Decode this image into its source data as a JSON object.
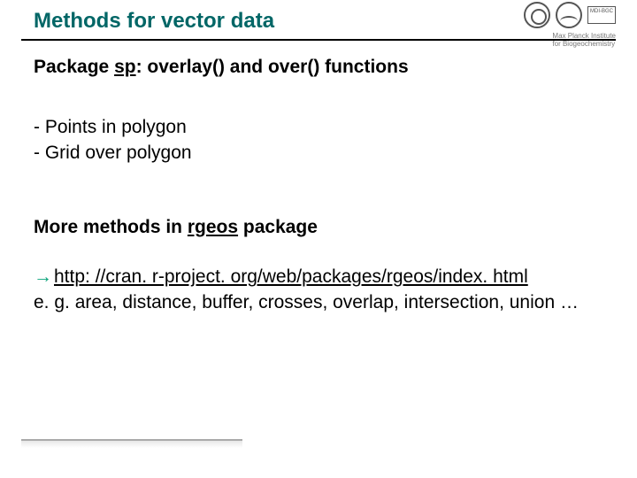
{
  "title": "Methods for vector data",
  "institute": "Max Planck Institute\nfor Biogeochemistry",
  "logo_box": "MDI-BGC",
  "section1": {
    "heading_prefix": "Package ",
    "heading_pkg": "sp",
    "heading_suffix": ": overlay() and over() functions",
    "bullets": [
      "- Points in polygon",
      "- Grid over polygon"
    ]
  },
  "section2": {
    "heading_prefix": "More methods in ",
    "heading_pkg": "rgeos",
    "heading_suffix": " package",
    "arrow": "→",
    "link": "http: //cran. r-project. org/web/packages/rgeos/index. html",
    "example": "e. g. area, distance, buffer, crosses, overlap, intersection, union …"
  }
}
